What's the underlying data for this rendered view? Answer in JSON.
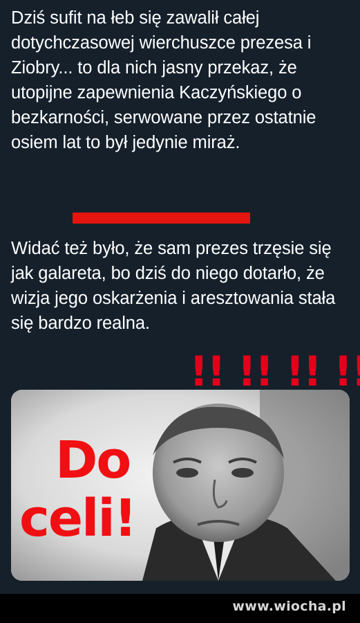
{
  "post": {
    "paragraph_1": "Dziś sufit na łeb się zawalił całej dotychczasowej wierchuszce prezesa i Ziobry... to dla nich jasny przekaz, że utopijne zapewnienia Kaczyńskiego o bezkarności, serwowane przez ostatnie osiem lat to był jedynie miraż.",
    "paragraph_2": "Widać też było, że sam prezes trzęsie się jak galareta, bo dziś do niego dotarło, że wizja jego oskarżenia i aresztowania stała się bardzo realna.",
    "exclamation_marks": "!! !! !! !!"
  },
  "media": {
    "overlay_line_1": "Do",
    "overlay_line_2": "celi!"
  },
  "footer": {
    "watermark": "www.wiocha.pl"
  },
  "colors": {
    "background": "#15202b",
    "accent_red": "#e4140f",
    "overlay_red": "#f00f12",
    "footer_bg": "#000000"
  }
}
